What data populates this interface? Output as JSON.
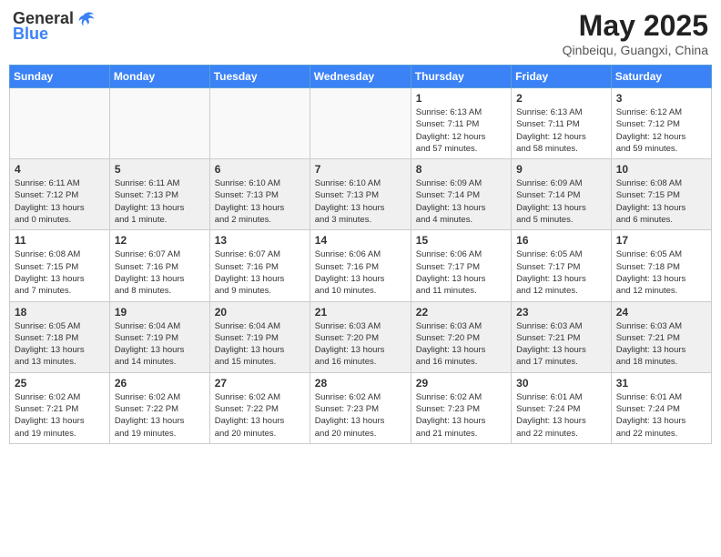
{
  "header": {
    "logo_general": "General",
    "logo_blue": "Blue",
    "month_year": "May 2025",
    "location": "Qinbeiqu, Guangxi, China"
  },
  "weekdays": [
    "Sunday",
    "Monday",
    "Tuesday",
    "Wednesday",
    "Thursday",
    "Friday",
    "Saturday"
  ],
  "weeks": [
    [
      {
        "day": "",
        "info": ""
      },
      {
        "day": "",
        "info": ""
      },
      {
        "day": "",
        "info": ""
      },
      {
        "day": "",
        "info": ""
      },
      {
        "day": "1",
        "info": "Sunrise: 6:13 AM\nSunset: 7:11 PM\nDaylight: 12 hours\nand 57 minutes."
      },
      {
        "day": "2",
        "info": "Sunrise: 6:13 AM\nSunset: 7:11 PM\nDaylight: 12 hours\nand 58 minutes."
      },
      {
        "day": "3",
        "info": "Sunrise: 6:12 AM\nSunset: 7:12 PM\nDaylight: 12 hours\nand 59 minutes."
      }
    ],
    [
      {
        "day": "4",
        "info": "Sunrise: 6:11 AM\nSunset: 7:12 PM\nDaylight: 13 hours\nand 0 minutes."
      },
      {
        "day": "5",
        "info": "Sunrise: 6:11 AM\nSunset: 7:13 PM\nDaylight: 13 hours\nand 1 minute."
      },
      {
        "day": "6",
        "info": "Sunrise: 6:10 AM\nSunset: 7:13 PM\nDaylight: 13 hours\nand 2 minutes."
      },
      {
        "day": "7",
        "info": "Sunrise: 6:10 AM\nSunset: 7:13 PM\nDaylight: 13 hours\nand 3 minutes."
      },
      {
        "day": "8",
        "info": "Sunrise: 6:09 AM\nSunset: 7:14 PM\nDaylight: 13 hours\nand 4 minutes."
      },
      {
        "day": "9",
        "info": "Sunrise: 6:09 AM\nSunset: 7:14 PM\nDaylight: 13 hours\nand 5 minutes."
      },
      {
        "day": "10",
        "info": "Sunrise: 6:08 AM\nSunset: 7:15 PM\nDaylight: 13 hours\nand 6 minutes."
      }
    ],
    [
      {
        "day": "11",
        "info": "Sunrise: 6:08 AM\nSunset: 7:15 PM\nDaylight: 13 hours\nand 7 minutes."
      },
      {
        "day": "12",
        "info": "Sunrise: 6:07 AM\nSunset: 7:16 PM\nDaylight: 13 hours\nand 8 minutes."
      },
      {
        "day": "13",
        "info": "Sunrise: 6:07 AM\nSunset: 7:16 PM\nDaylight: 13 hours\nand 9 minutes."
      },
      {
        "day": "14",
        "info": "Sunrise: 6:06 AM\nSunset: 7:16 PM\nDaylight: 13 hours\nand 10 minutes."
      },
      {
        "day": "15",
        "info": "Sunrise: 6:06 AM\nSunset: 7:17 PM\nDaylight: 13 hours\nand 11 minutes."
      },
      {
        "day": "16",
        "info": "Sunrise: 6:05 AM\nSunset: 7:17 PM\nDaylight: 13 hours\nand 12 minutes."
      },
      {
        "day": "17",
        "info": "Sunrise: 6:05 AM\nSunset: 7:18 PM\nDaylight: 13 hours\nand 12 minutes."
      }
    ],
    [
      {
        "day": "18",
        "info": "Sunrise: 6:05 AM\nSunset: 7:18 PM\nDaylight: 13 hours\nand 13 minutes."
      },
      {
        "day": "19",
        "info": "Sunrise: 6:04 AM\nSunset: 7:19 PM\nDaylight: 13 hours\nand 14 minutes."
      },
      {
        "day": "20",
        "info": "Sunrise: 6:04 AM\nSunset: 7:19 PM\nDaylight: 13 hours\nand 15 minutes."
      },
      {
        "day": "21",
        "info": "Sunrise: 6:03 AM\nSunset: 7:20 PM\nDaylight: 13 hours\nand 16 minutes."
      },
      {
        "day": "22",
        "info": "Sunrise: 6:03 AM\nSunset: 7:20 PM\nDaylight: 13 hours\nand 16 minutes."
      },
      {
        "day": "23",
        "info": "Sunrise: 6:03 AM\nSunset: 7:21 PM\nDaylight: 13 hours\nand 17 minutes."
      },
      {
        "day": "24",
        "info": "Sunrise: 6:03 AM\nSunset: 7:21 PM\nDaylight: 13 hours\nand 18 minutes."
      }
    ],
    [
      {
        "day": "25",
        "info": "Sunrise: 6:02 AM\nSunset: 7:21 PM\nDaylight: 13 hours\nand 19 minutes."
      },
      {
        "day": "26",
        "info": "Sunrise: 6:02 AM\nSunset: 7:22 PM\nDaylight: 13 hours\nand 19 minutes."
      },
      {
        "day": "27",
        "info": "Sunrise: 6:02 AM\nSunset: 7:22 PM\nDaylight: 13 hours\nand 20 minutes."
      },
      {
        "day": "28",
        "info": "Sunrise: 6:02 AM\nSunset: 7:23 PM\nDaylight: 13 hours\nand 20 minutes."
      },
      {
        "day": "29",
        "info": "Sunrise: 6:02 AM\nSunset: 7:23 PM\nDaylight: 13 hours\nand 21 minutes."
      },
      {
        "day": "30",
        "info": "Sunrise: 6:01 AM\nSunset: 7:24 PM\nDaylight: 13 hours\nand 22 minutes."
      },
      {
        "day": "31",
        "info": "Sunrise: 6:01 AM\nSunset: 7:24 PM\nDaylight: 13 hours\nand 22 minutes."
      }
    ]
  ]
}
